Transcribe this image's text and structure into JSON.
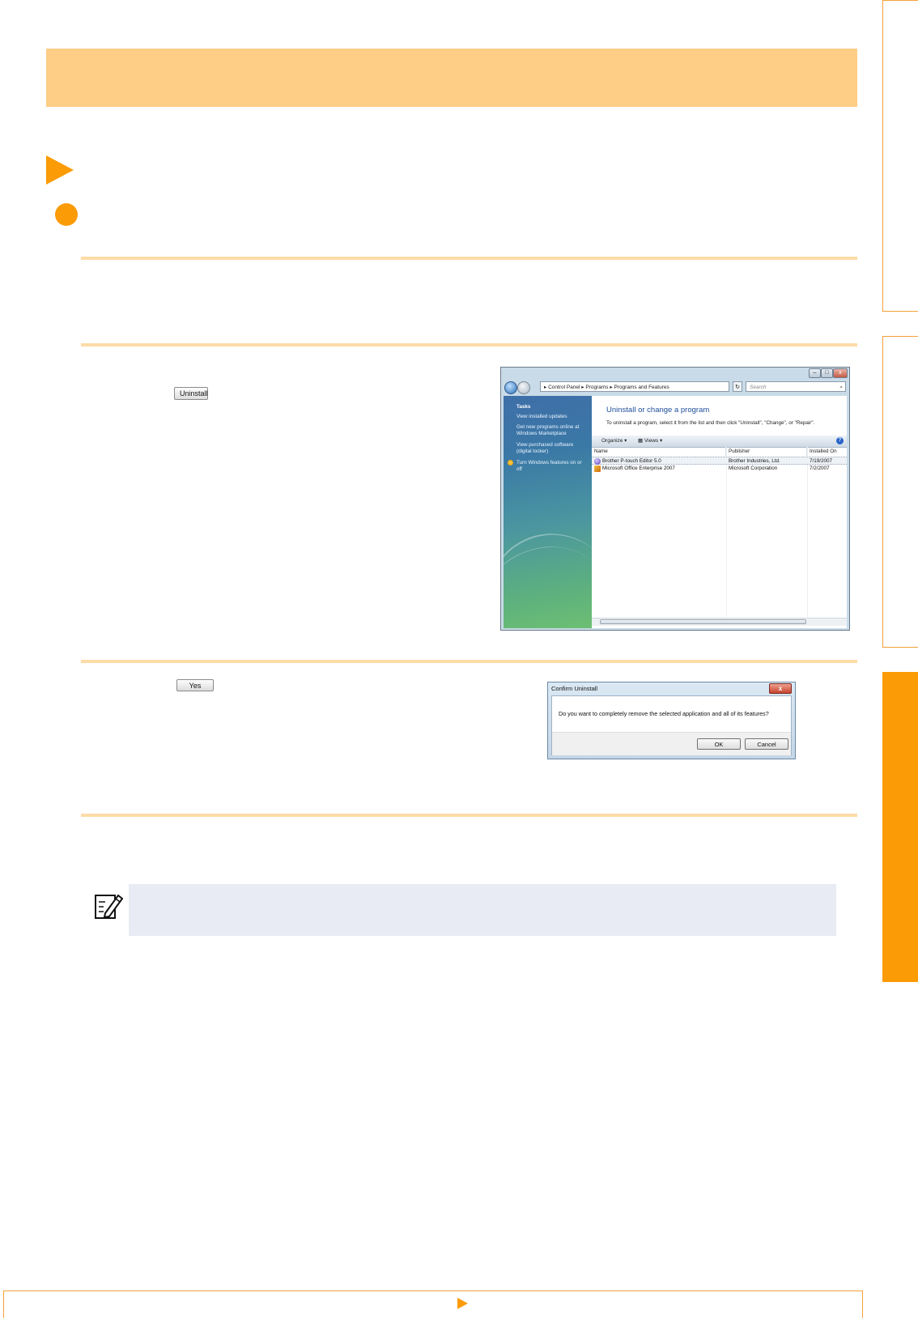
{
  "step2": {
    "uninstall_button": "Uninstall",
    "window": {
      "address_root": "▸",
      "address_path": [
        "Control Panel",
        "Programs",
        "Programs and Features"
      ],
      "search_placeholder": "Search",
      "tasks_title": "Tasks",
      "tasks": [
        "View installed updates",
        "Get new programs online at Windows Marketplace",
        "View purchased software (digital locker)",
        "Turn Windows features on or off"
      ],
      "main_title": "Uninstall or change a program",
      "main_desc": "To uninstall a program, select it from the list and then click \"Uninstall\", \"Change\", or \"Repair\".",
      "toolbar": {
        "organize": "Organize",
        "views": "Views"
      },
      "columns": [
        "Name",
        "Publisher",
        "Installed On"
      ],
      "rows": [
        {
          "name": "Brother P-touch Editor 5.0",
          "publisher": "Brother Industries, Ltd.",
          "installed": "7/19/2007"
        },
        {
          "name": "Microsoft Office Enterprise 2007",
          "publisher": "Microsoft Corporation",
          "installed": "7/2/2007"
        }
      ]
    }
  },
  "step3": {
    "yes_button": "Yes",
    "dialog": {
      "title": "Confirm Uninstall",
      "message": "Do you want to completely remove the selected application and all of its features?",
      "ok": "OK",
      "cancel": "Cancel",
      "close": "x"
    }
  },
  "colors": {
    "accent": "#fb9b06",
    "header": "#fecd86",
    "rule": "#fedca7",
    "note": "#e8ebf4"
  }
}
